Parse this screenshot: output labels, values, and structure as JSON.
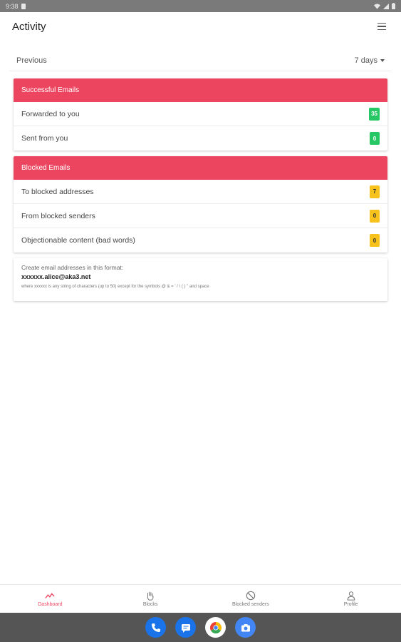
{
  "status_bar": {
    "time": "9:38"
  },
  "app_bar": {
    "title": "Activity",
    "menu_icon": "hamburger-menu-icon"
  },
  "period": {
    "label": "Previous",
    "range": "7 days"
  },
  "successful": {
    "header": "Successful Emails",
    "rows": [
      {
        "label": "Forwarded to you",
        "count": "35"
      },
      {
        "label": "Sent from you",
        "count": "0"
      }
    ]
  },
  "blocked": {
    "header": "Blocked Emails",
    "rows": [
      {
        "label": "To blocked addresses",
        "count": "7"
      },
      {
        "label": "From blocked senders",
        "count": "0"
      },
      {
        "label": "Objectionable content (bad words)",
        "count": "0"
      }
    ]
  },
  "info": {
    "line1": "Create email addresses in this format:",
    "line2": "xxxxxx.alice@aka3.net",
    "line3": "where xxxxxx is any string of characters (up to 50) except for the symbols @ & = ' / \\ ( ) \" and space"
  },
  "bottom_nav": [
    {
      "label": "Dashboard",
      "icon": "chart-line-icon",
      "active": true
    },
    {
      "label": "Blocks",
      "icon": "hand-stop-icon",
      "active": false
    },
    {
      "label": "Blocked senders",
      "icon": "block-circle-icon",
      "active": false
    },
    {
      "label": "Profile",
      "icon": "person-icon",
      "active": false
    }
  ],
  "dock": [
    {
      "icon": "phone-icon",
      "color": "#1a73e8"
    },
    {
      "icon": "messages-icon",
      "color": "#1a73e8"
    },
    {
      "icon": "chrome-icon",
      "color": "#ffffff"
    },
    {
      "icon": "camera-icon",
      "color": "#4285f4"
    }
  ],
  "colors": {
    "accent": "#ec4560",
    "badge_green": "#28c766",
    "badge_yellow": "#f7c21c"
  }
}
